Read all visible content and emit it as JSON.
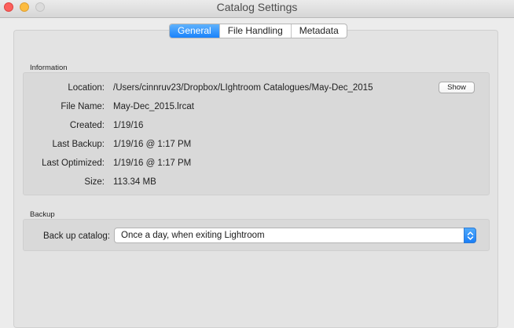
{
  "window": {
    "title": "Catalog Settings"
  },
  "tabs": [
    {
      "label": "General",
      "active": true
    },
    {
      "label": "File Handling",
      "active": false
    },
    {
      "label": "Metadata",
      "active": false
    }
  ],
  "information": {
    "section_label": "Information",
    "show_button_label": "Show",
    "rows": [
      {
        "label": "Location:",
        "value": "/Users/cinnruv23/Dropbox/LIghtroom Catalogues/May-Dec_2015"
      },
      {
        "label": "File Name:",
        "value": "May-Dec_2015.lrcat"
      },
      {
        "label": "Created:",
        "value": "1/19/16"
      },
      {
        "label": "Last Backup:",
        "value": "1/19/16 @ 1:17 PM"
      },
      {
        "label": "Last Optimized:",
        "value": "1/19/16 @ 1:17 PM"
      },
      {
        "label": "Size:",
        "value": "113.34 MB"
      }
    ]
  },
  "backup": {
    "section_label": "Backup",
    "field_label": "Back up catalog:",
    "selected_option": "Once a day, when exiting Lightroom"
  },
  "colors": {
    "accent": "#1a82fb",
    "close": "#fc605c",
    "minimize": "#fdbc40",
    "zoom_disabled": "#dcdcdc"
  },
  "icons": {
    "close": "close-icon",
    "minimize": "minimize-icon",
    "zoom": "zoom-icon",
    "select_arrows": "chevron-up-down-icon"
  }
}
